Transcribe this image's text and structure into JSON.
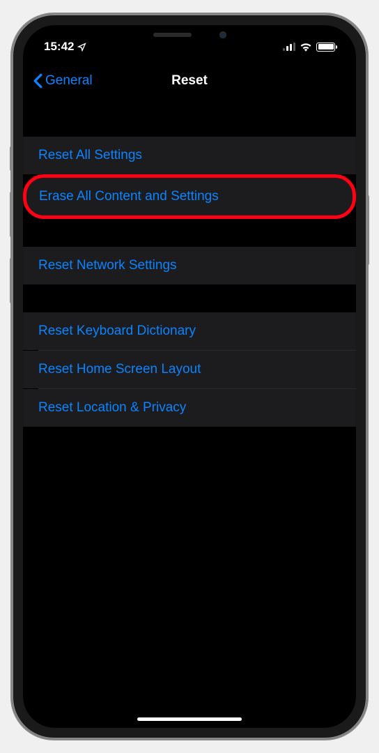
{
  "statusBar": {
    "time": "15:42"
  },
  "navBar": {
    "backLabel": "General",
    "title": "Reset"
  },
  "groups": [
    {
      "items": [
        {
          "label": "Reset All Settings",
          "highlighted": false
        },
        {
          "label": "Erase All Content and Settings",
          "highlighted": true
        }
      ]
    },
    {
      "items": [
        {
          "label": "Reset Network Settings",
          "highlighted": false
        }
      ]
    },
    {
      "items": [
        {
          "label": "Reset Keyboard Dictionary",
          "highlighted": false
        },
        {
          "label": "Reset Home Screen Layout",
          "highlighted": false
        },
        {
          "label": "Reset Location & Privacy",
          "highlighted": false
        }
      ]
    }
  ]
}
